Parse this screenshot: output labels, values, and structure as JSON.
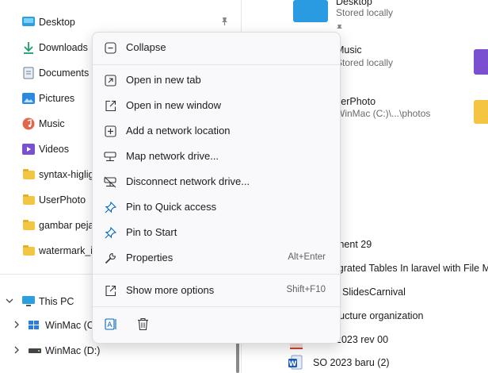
{
  "nav": {
    "items": [
      {
        "label": "Desktop",
        "icon": "desktop-icon"
      },
      {
        "label": "Downloads",
        "icon": "download-icon"
      },
      {
        "label": "Documents",
        "icon": "documents-icon"
      },
      {
        "label": "Pictures",
        "icon": "pictures-icon"
      },
      {
        "label": "Music",
        "icon": "music-icon"
      },
      {
        "label": "Videos",
        "icon": "videos-icon"
      },
      {
        "label": "syntax-higlig",
        "icon": "folder-icon"
      },
      {
        "label": "UserPhoto",
        "icon": "folder-icon"
      },
      {
        "label": "gambar peja",
        "icon": "folder-icon"
      },
      {
        "label": "watermark_i",
        "icon": "folder-icon"
      }
    ],
    "this_pc": "This PC",
    "drives": [
      {
        "label": "WinMac (C"
      },
      {
        "label": "WinMac (D:)"
      }
    ]
  },
  "content": {
    "tiles": [
      {
        "title": "Desktop",
        "subtitle": "Stored locally"
      },
      {
        "title": "Music",
        "subtitle": "Stored locally"
      },
      {
        "title": "serPhoto",
        "subtitle": "WinMac (C:)\\...\\photos"
      }
    ],
    "files": [
      {
        "name": "ment 29"
      },
      {
        "name": "igrated Tables In laravel with File Mi"
      },
      {
        "name": "SlidesCarnival"
      },
      {
        "name": "ructure organization"
      },
      {
        "name": "2023 rev 00"
      },
      {
        "name": "SO 2023 baru (2)"
      }
    ]
  },
  "context_menu": {
    "collapse": "Collapse",
    "items": [
      {
        "label": "Open in new tab",
        "icon": "open-new-tab-icon"
      },
      {
        "label": "Open in new window",
        "icon": "open-new-window-icon"
      },
      {
        "label": "Add a network location",
        "icon": "network-location-icon"
      },
      {
        "label": "Map network drive...",
        "icon": "map-drive-icon"
      },
      {
        "label": "Disconnect network drive...",
        "icon": "disconnect-drive-icon"
      },
      {
        "label": "Pin to Quick access",
        "icon": "pin-icon"
      },
      {
        "label": "Pin to Start",
        "icon": "pin-icon"
      },
      {
        "label": "Properties",
        "icon": "wrench-icon",
        "shortcut": "Alt+Enter"
      }
    ],
    "more": {
      "label": "Show more options",
      "shortcut": "Shift+F10"
    }
  },
  "colors": {
    "accent": "#0067c0",
    "folder": "#f4c542"
  }
}
